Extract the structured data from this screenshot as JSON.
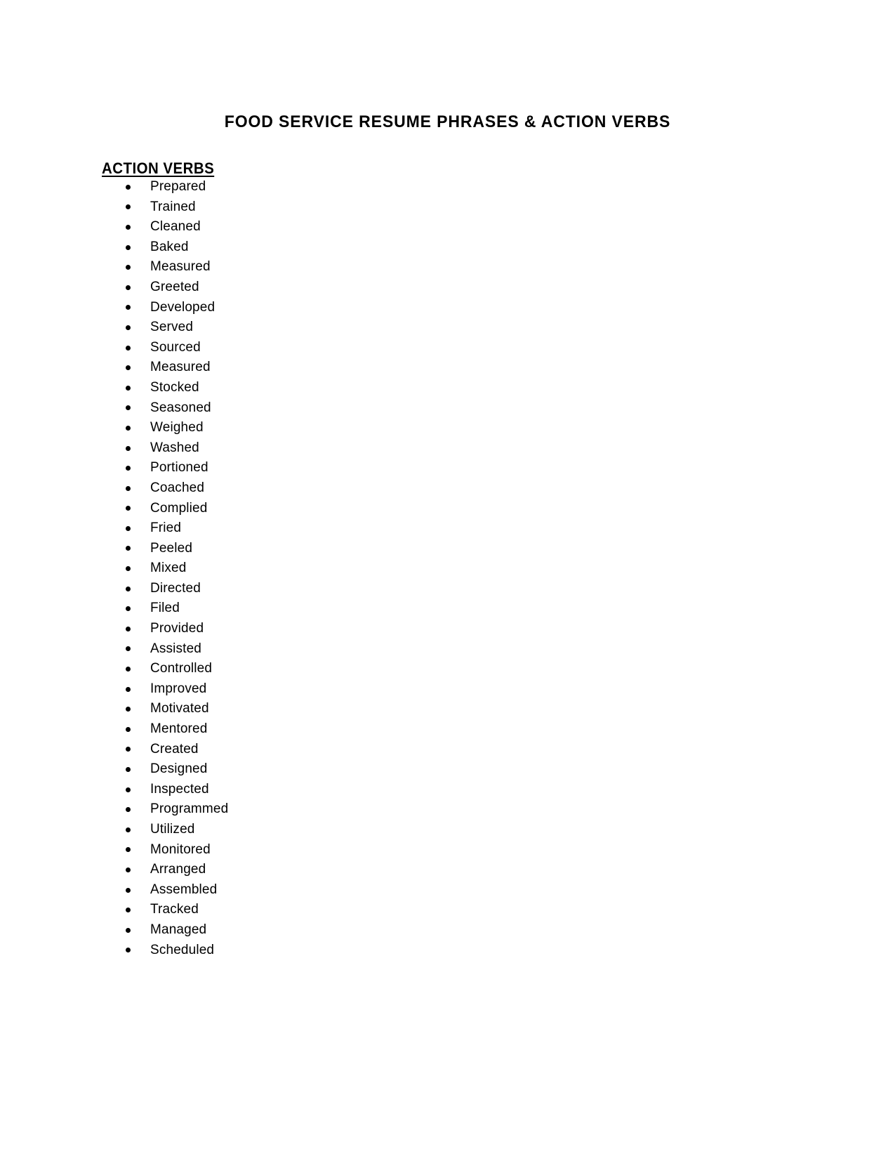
{
  "document": {
    "title": "FOOD SERVICE RESUME PHRASES & ACTION VERBS",
    "background_color": "#ffffff",
    "text_color": "#000000"
  },
  "section": {
    "heading": "ACTION VERBS"
  },
  "action_verbs": [
    "Prepared",
    "Trained",
    "Cleaned",
    "Baked",
    "Measured",
    "Greeted",
    "Developed",
    "Served",
    "Sourced",
    "Measured",
    "Stocked",
    "Seasoned",
    "Weighed",
    "Washed",
    "Portioned",
    "Coached",
    "Complied",
    "Fried",
    "Peeled",
    "Mixed",
    "Directed",
    "Filed",
    "Provided",
    "Assisted",
    "Controlled",
    "Improved",
    "Motivated",
    "Mentored",
    "Created",
    "Designed",
    "Inspected",
    "Programmed",
    "Utilized",
    "Monitored",
    "Arranged",
    "Assembled",
    "Tracked",
    "Managed",
    "Scheduled"
  ]
}
